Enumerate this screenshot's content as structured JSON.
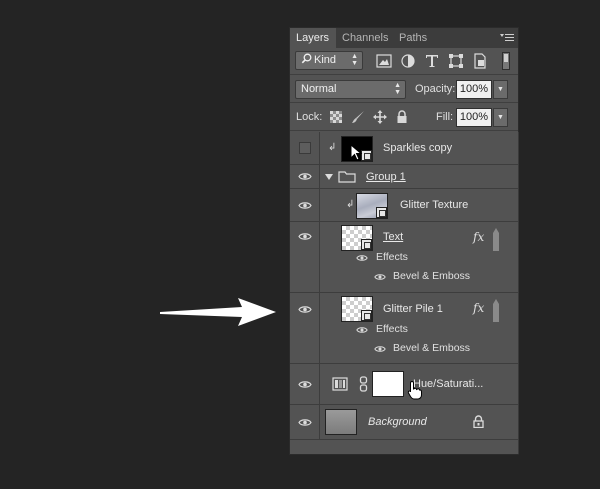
{
  "tabs": [
    {
      "label": "Layers",
      "active": true
    },
    {
      "label": "Channels",
      "active": false
    },
    {
      "label": "Paths",
      "active": false
    }
  ],
  "filter": {
    "kind_label": "Kind",
    "icons": [
      "image-filter-icon",
      "adjustment-filter-icon",
      "type-filter-icon",
      "shape-filter-icon",
      "smart-object-filter-icon"
    ]
  },
  "blend": {
    "mode": "Normal",
    "opacity_label": "Opacity:",
    "opacity_value": "100%"
  },
  "lock": {
    "label": "Lock:",
    "fill_label": "Fill:",
    "fill_value": "100%"
  },
  "layers": [
    {
      "name": "Sparkles copy",
      "visible": false
    },
    {
      "name": "Group 1",
      "visible": true,
      "type": "group"
    },
    {
      "name": "Glitter Texture",
      "visible": true
    },
    {
      "name": "Text",
      "visible": true,
      "fx": "fx",
      "effects_label": "Effects",
      "effect": "Bevel & Emboss"
    },
    {
      "name": "Glitter Pile 1",
      "visible": true,
      "fx": "fx",
      "effects_label": "Effects",
      "effect": "Bevel & Emboss"
    },
    {
      "name": "Hue/Saturati...",
      "visible": true,
      "type": "adjustment"
    },
    {
      "name": "Background",
      "visible": true,
      "locked": true
    }
  ],
  "colors": {
    "panel_bg": "#535353",
    "tabbar_bg": "#3c3c3c",
    "canvas_bg": "#242424",
    "arrow": "#ffffff"
  }
}
